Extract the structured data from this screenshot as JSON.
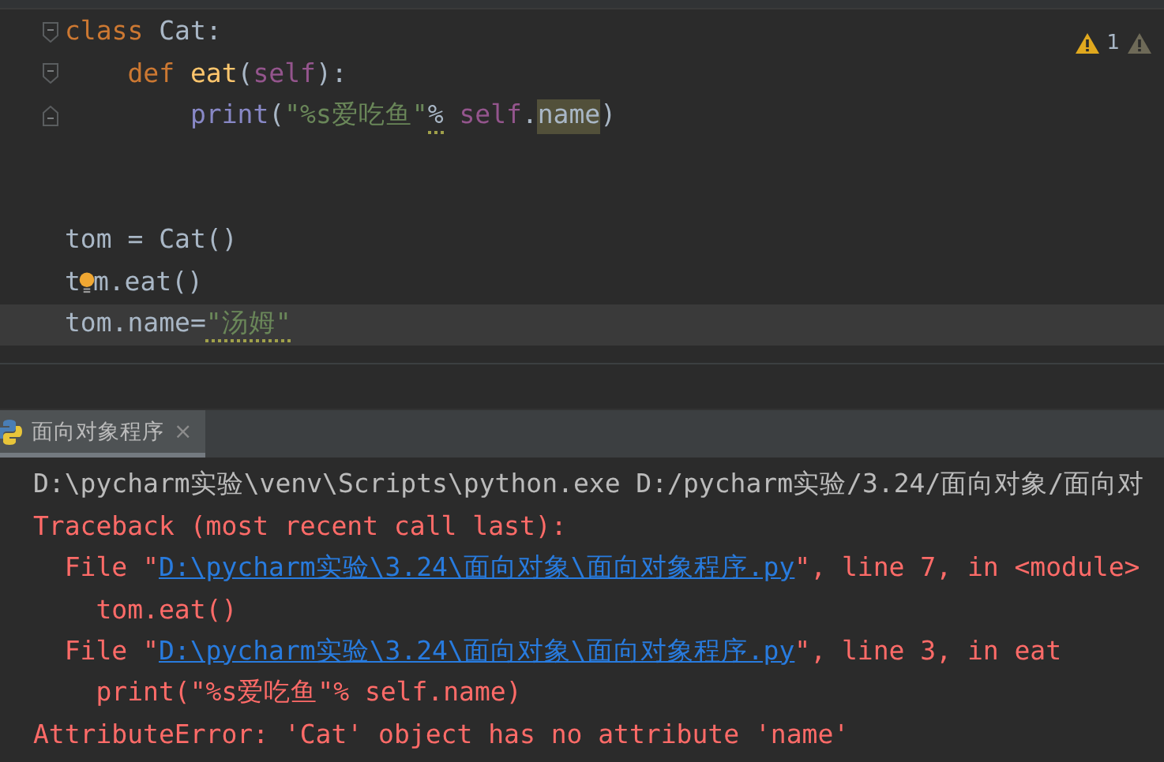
{
  "editor": {
    "inspection": {
      "count": "1"
    },
    "lines": [
      {
        "fold_open": true,
        "current": false,
        "tokens": [
          {
            "text": "class",
            "kind": "keyword"
          },
          {
            "text": " Cat:",
            "kind": "plain"
          }
        ]
      },
      {
        "fold_open": true,
        "current": false,
        "tokens": [
          {
            "text": "    def",
            "kind": "keyword"
          },
          {
            "text": " eat",
            "kind": "function"
          },
          {
            "text": "(",
            "kind": "plain"
          },
          {
            "text": "self",
            "kind": "self"
          },
          {
            "text": "):",
            "kind": "plain"
          }
        ]
      },
      {
        "fold_close": true,
        "current": false,
        "tokens": [
          {
            "text": "        print",
            "kind": "builtin"
          },
          {
            "text": "(",
            "kind": "plain"
          },
          {
            "text": "\"%s爱吃鱼\"",
            "kind": "string"
          },
          {
            "text": "%",
            "kind": "plain",
            "warning": true
          },
          {
            "text": " self",
            "kind": "self"
          },
          {
            "text": ".",
            "kind": "plain"
          },
          {
            "text": "name",
            "kind": "plain",
            "highlight": true
          },
          {
            "text": ")",
            "kind": "plain"
          }
        ]
      },
      {
        "current": false
      },
      {
        "current": false
      },
      {
        "current": false,
        "tokens": [
          {
            "text": "tom = Cat()",
            "kind": "plain"
          }
        ]
      },
      {
        "current": false,
        "tokens": [
          {
            "text": "t",
            "kind": "plain"
          },
          {
            "kind": "bulb"
          },
          {
            "text": "m.eat()",
            "kind": "plain"
          }
        ]
      },
      {
        "current": true,
        "tokens": [
          {
            "text": "tom.name=",
            "kind": "plain"
          },
          {
            "text": "\"汤姆\"",
            "kind": "string",
            "warning": true
          }
        ]
      }
    ]
  },
  "run_panel": {
    "tab": {
      "label": "面向对象程序",
      "close": "×",
      "selected": true
    },
    "lines": [
      {
        "kind": "command",
        "segments": [
          {
            "text": "D:\\pycharm实验\\venv\\Scripts\\python.exe D:/pycharm实验/3.24/面向对象/面向对",
            "kind": "text"
          }
        ]
      },
      {
        "kind": "error",
        "segments": [
          {
            "text": "Traceback (most recent call last):",
            "kind": "text"
          }
        ]
      },
      {
        "kind": "error",
        "segments": [
          {
            "text": "  File \"",
            "kind": "text"
          },
          {
            "text": "D:\\pycharm实验\\3.24\\面向对象\\面向对象程序.py",
            "kind": "link"
          },
          {
            "text": "\", line 7, in <module>",
            "kind": "text"
          }
        ]
      },
      {
        "kind": "error",
        "segments": [
          {
            "text": "    tom.eat()",
            "kind": "text"
          }
        ]
      },
      {
        "kind": "error",
        "segments": [
          {
            "text": "  File \"",
            "kind": "text"
          },
          {
            "text": "D:\\pycharm实验\\3.24\\面向对象\\面向对象程序.py",
            "kind": "link"
          },
          {
            "text": "\", line 3, in eat",
            "kind": "text"
          }
        ]
      },
      {
        "kind": "error",
        "segments": [
          {
            "text": "    print(\"%s爱吃鱼\"% self.name)",
            "kind": "text"
          }
        ]
      },
      {
        "kind": "error",
        "segments": [
          {
            "text": "AttributeError: 'Cat' object has no attribute 'name'",
            "kind": "text"
          }
        ]
      }
    ]
  }
}
